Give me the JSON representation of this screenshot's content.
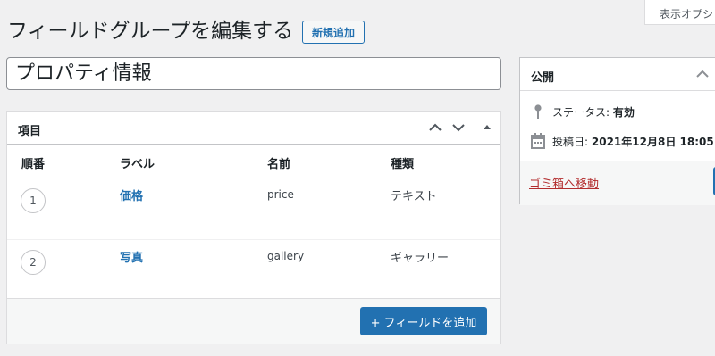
{
  "header": {
    "screen_options_label": "表示オプション",
    "page_title": "フィールドグループを編集する",
    "add_new_label": "新規追加"
  },
  "title_field": {
    "value": "プロパティ情報"
  },
  "fields_box": {
    "title": "項目",
    "columns": [
      "順番",
      "ラベル",
      "名前",
      "種類"
    ],
    "rows": [
      {
        "order": "1",
        "label": "価格",
        "name": "price",
        "type": "テキスト"
      },
      {
        "order": "2",
        "label": "写真",
        "name": "gallery",
        "type": "ギャラリー"
      }
    ],
    "add_field_label": "+ フィールドを追加"
  },
  "publish_box": {
    "title": "公開",
    "status_label": "ステータス:",
    "status_value": "有効",
    "date_label": "投稿日:",
    "date_value": "2021年12月8日 18:05",
    "trash_label": "ゴミ箱へ移動"
  },
  "colors": {
    "accent": "#2271b1",
    "trash": "#b32d2e",
    "background": "#f0f0f1"
  },
  "icons": [
    "chevron-up-icon",
    "chevron-down-icon",
    "triangle-up-icon",
    "pin-icon",
    "calendar-icon"
  ]
}
